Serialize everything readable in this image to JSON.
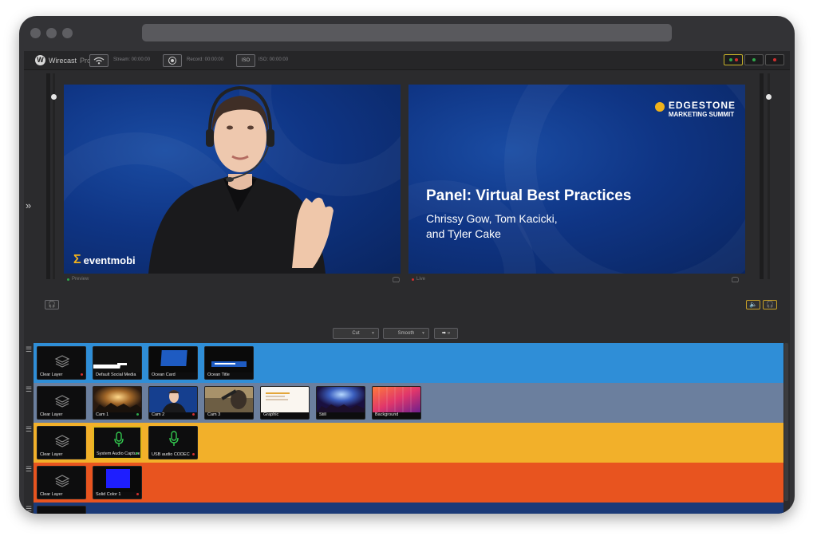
{
  "app": {
    "name": "Wirecast",
    "edition": "Pro",
    "stream_label": "Stream: 00:00:00",
    "record_label": "Record: 00:00:00",
    "iso_label": "ISO: 00:00:00",
    "iso_button": "ISO"
  },
  "preview": {
    "status": "Preview",
    "logo_text": "eventmobi"
  },
  "live": {
    "status": "Live",
    "brand_name": "EDGESTONE",
    "brand_sub": "MARKETING SUMMIT",
    "title": "Panel: Virtual Best Practices",
    "names_line1": "Chrissy Gow, Tom Kacicki,",
    "names_line2": "and Tyler Cake"
  },
  "transitions": {
    "cut": "Cut",
    "smooth": "Smooth",
    "go": "➡ ○"
  },
  "layers": [
    {
      "color": "#2f8ed7",
      "shots": [
        {
          "label": "Clear Layer",
          "dot": "#d12f2f",
          "thumb": "layers"
        },
        {
          "label": "Default Social Media",
          "dot": "",
          "thumb": "social"
        },
        {
          "label": "Ocean Card",
          "dot": "",
          "thumb": "card"
        },
        {
          "label": "Ocean Title",
          "dot": "",
          "thumb": "title"
        }
      ]
    },
    {
      "color": "#6b7f9e",
      "shots": [
        {
          "label": "Clear Layer",
          "dot": "",
          "thumb": "layers"
        },
        {
          "label": "Cam 1",
          "dot": "#2fa84a",
          "thumb": "cam1"
        },
        {
          "label": "Cam 2",
          "dot": "#d12f2f",
          "thumb": "cam2"
        },
        {
          "label": "Cam 3",
          "dot": "",
          "thumb": "cam3"
        },
        {
          "label": "Graphic",
          "dot": "",
          "thumb": "graphic"
        },
        {
          "label": "Still",
          "dot": "",
          "thumb": "still"
        },
        {
          "label": "Background",
          "dot": "",
          "thumb": "background"
        }
      ]
    },
    {
      "color": "#f2b02a",
      "shots": [
        {
          "label": "Clear Layer",
          "dot": "",
          "thumb": "layers"
        },
        {
          "label": "System Audio Capture",
          "dot": "#2fa84a",
          "thumb": "mic",
          "selected": true
        },
        {
          "label": "USB audio CODEC",
          "dot": "#d12f2f",
          "thumb": "mic"
        }
      ]
    },
    {
      "color": "#e8541f",
      "shots": [
        {
          "label": "Clear Layer",
          "dot": "",
          "thumb": "layers"
        },
        {
          "label": "Solid Color 1",
          "dot": "#d12f2f",
          "thumb": "solid"
        }
      ]
    },
    {
      "color": "#1b3a78",
      "shots": [
        {
          "label": "",
          "dot": "",
          "thumb": "layers"
        }
      ]
    }
  ],
  "colors": {
    "accent": "#f0b21b",
    "live_red": "#d12f2f",
    "preview_green": "#2fa84a"
  }
}
